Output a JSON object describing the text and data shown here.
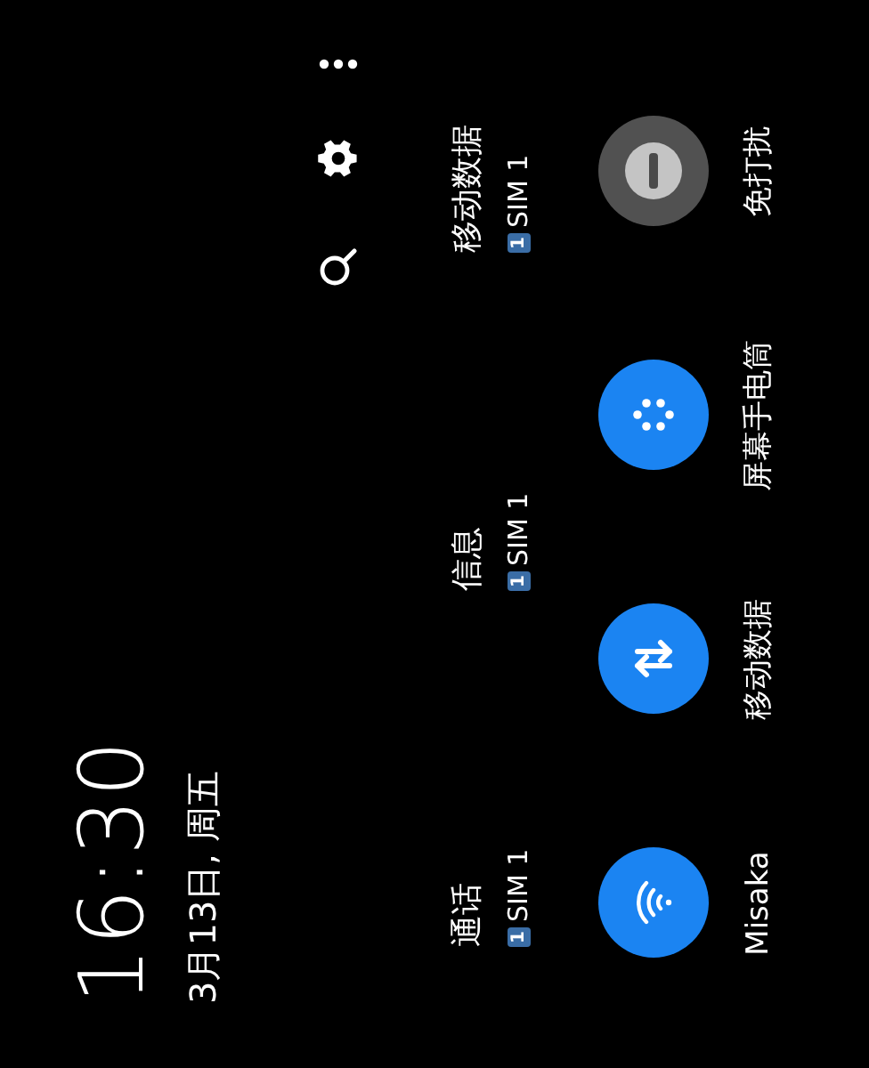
{
  "clock": {
    "time": "16:30",
    "date": "3月13日, 周五"
  },
  "header_actions": [
    {
      "kind": "search"
    },
    {
      "kind": "settings"
    },
    {
      "kind": "more"
    }
  ],
  "shortcuts": [
    {
      "label": "通话",
      "sim_badge": "1",
      "sim": "SIM 1"
    },
    {
      "label": "信息",
      "sim_badge": "1",
      "sim": "SIM 1"
    },
    {
      "label": "移动数据",
      "sim_badge": "1",
      "sim": "SIM 1"
    }
  ],
  "tiles": [
    {
      "label": "Misaka",
      "kind": "wifi",
      "on": true
    },
    {
      "label": "移动数据",
      "kind": "data",
      "on": true
    },
    {
      "label": "屏幕手电筒",
      "kind": "flashlight",
      "on": true
    },
    {
      "label": "免打扰",
      "kind": "dnd",
      "on": false
    }
  ]
}
